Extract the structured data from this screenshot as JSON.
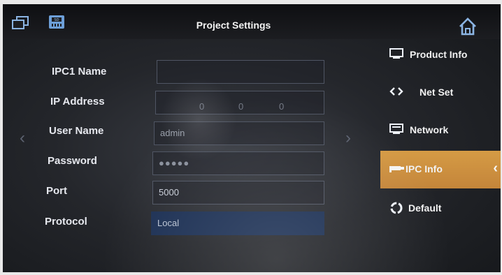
{
  "header": {
    "title": "Project Settings",
    "icons": [
      "multi-window-icon",
      "sd-card-icon",
      "home-icon"
    ]
  },
  "form": {
    "ipc_name_label": "IPC1 Name",
    "ip_address_label": "IP Address",
    "ip_octets": [
      "0",
      "0",
      "0"
    ],
    "user_name_label": "User Name",
    "user_name_value": "admin",
    "password_label": "Password",
    "password_mask": "●●●●●",
    "port_label": "Port",
    "port_value": "5000",
    "protocol_label": "Protocol",
    "protocol_value": "Local"
  },
  "sidebar": {
    "items": [
      {
        "label": "Product Info",
        "icon": "monitor-icon"
      },
      {
        "label": "Net Set",
        "icon": "code-arrows-icon"
      },
      {
        "label": "Network",
        "icon": "network-monitor-icon"
      },
      {
        "label": "IPC Info",
        "icon": "camera-icon",
        "active": true
      },
      {
        "label": "Default",
        "icon": "recycle-icon"
      }
    ]
  },
  "colors": {
    "accent": "#c98a3c",
    "icon_blue": "#8bb4e3",
    "protocol_field": "#1b2f53"
  }
}
